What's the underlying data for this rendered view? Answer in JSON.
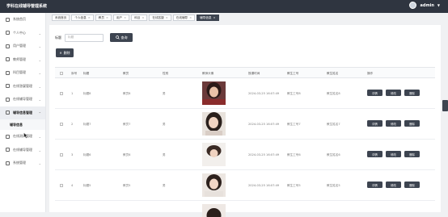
{
  "header": {
    "title": "学科在线辅导管理系统",
    "user": "admin"
  },
  "sidebar": {
    "items": [
      {
        "label": "系统首页",
        "icon": "home-icon"
      },
      {
        "label": "个人中心",
        "icon": "user-icon",
        "chev": true
      },
      {
        "label": "用户管理",
        "icon": "users-icon",
        "chev": true
      },
      {
        "label": "教师管理",
        "icon": "teacher-icon",
        "chev": true
      },
      {
        "label": "科目管理",
        "icon": "book-icon",
        "chev": true
      },
      {
        "label": "在线答疑管理",
        "icon": "question-icon",
        "chev": true
      },
      {
        "label": "在线辅导管理",
        "icon": "lesson-icon",
        "chev": true
      },
      {
        "label": "辅导信息管理",
        "icon": "info-icon",
        "chev": true,
        "active": true
      },
      {
        "label": "在线测试管理",
        "icon": "test-icon",
        "chev": true
      },
      {
        "label": "在线辅导管理",
        "icon": "tutor-icon",
        "chev": true
      },
      {
        "label": "系统管理",
        "icon": "settings-icon",
        "chev": true
      }
    ],
    "subitem": "辅导信息"
  },
  "tabs": [
    {
      "label": "系统首页"
    },
    {
      "label": "个人信息"
    },
    {
      "label": "教员"
    },
    {
      "label": "用户"
    },
    {
      "label": "科目"
    },
    {
      "label": "在线答疑"
    },
    {
      "label": "在线辅导"
    },
    {
      "label": "辅导信息",
      "current": true
    }
  ],
  "search": {
    "label": "标题",
    "placeholder": "标题",
    "button": "查询"
  },
  "delete_button": "删除",
  "table": {
    "headers": [
      "序号",
      "标题",
      "教员",
      "性别",
      "教师头像",
      "授课时间",
      "教生工号",
      "教生姓名",
      "操作"
    ],
    "rows": [
      {
        "index": "1",
        "title": "标题8",
        "teacher": "教员8",
        "gender": "男",
        "time": "2024-03-25 16:07:49",
        "empno": "教生工号8",
        "name": "教生姓名8",
        "photo": "a"
      },
      {
        "index": "2",
        "title": "标题7",
        "teacher": "教员7",
        "gender": "男",
        "time": "2024-03-25 16:07:49",
        "empno": "教生工号7",
        "name": "教生姓名7",
        "photo": "b"
      },
      {
        "index": "3",
        "title": "标题6",
        "teacher": "教员6",
        "gender": "男",
        "time": "2024-03-25 16:07:49",
        "empno": "教生工号6",
        "name": "教生姓名6",
        "photo": "c"
      },
      {
        "index": "4",
        "title": "标题5",
        "teacher": "教员5",
        "gender": "男",
        "time": "2024-03-25 16:07:49",
        "empno": "教生工号5",
        "name": "教生姓名5",
        "photo": "d"
      }
    ],
    "actions": [
      "详情",
      "修改",
      "删除"
    ]
  }
}
